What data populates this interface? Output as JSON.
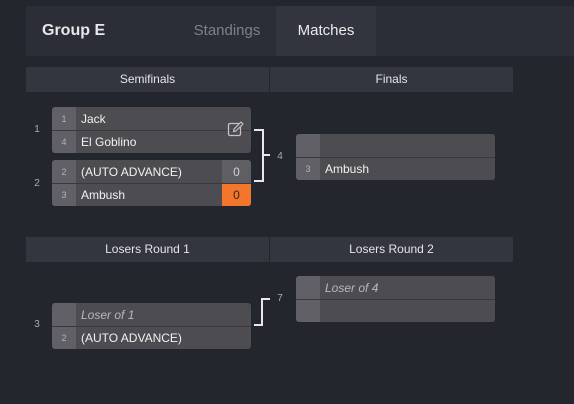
{
  "header": {
    "title": "Group E",
    "tabs": [
      {
        "label": "Standings",
        "active": false
      },
      {
        "label": "Matches",
        "active": true
      }
    ]
  },
  "winners": {
    "rounds": [
      "Semifinals",
      "Finals"
    ],
    "matches": [
      {
        "number": "1",
        "slots": [
          {
            "seed": "1",
            "name": "Jack",
            "score": ""
          },
          {
            "seed": "4",
            "name": "El Goblino",
            "score": ""
          }
        ],
        "edit_icon": "edit-icon"
      },
      {
        "number": "2",
        "slots": [
          {
            "seed": "2",
            "name": "(AUTO ADVANCE)",
            "score": "0"
          },
          {
            "seed": "3",
            "name": "Ambush",
            "score": "0",
            "winner": true
          }
        ]
      },
      {
        "number": "4",
        "slots": [
          {
            "seed": "",
            "name": "",
            "score": ""
          },
          {
            "seed": "3",
            "name": "Ambush",
            "score": ""
          }
        ]
      }
    ]
  },
  "losers": {
    "rounds": [
      "Losers Round 1",
      "Losers Round 2"
    ],
    "matches": [
      {
        "number": "3",
        "slots": [
          {
            "seed": "",
            "name": "Loser of 1",
            "placeholder": true
          },
          {
            "seed": "2",
            "name": "(AUTO ADVANCE)"
          }
        ]
      },
      {
        "number": "7",
        "slots": [
          {
            "seed": "",
            "name": "Loser of 4",
            "placeholder": true
          },
          {
            "seed": "",
            "name": ""
          }
        ]
      }
    ]
  },
  "colors": {
    "background": "#24262e",
    "panel": "#2c2e37",
    "match_box": "#4d4d51",
    "winner_score": "#f2762b"
  }
}
